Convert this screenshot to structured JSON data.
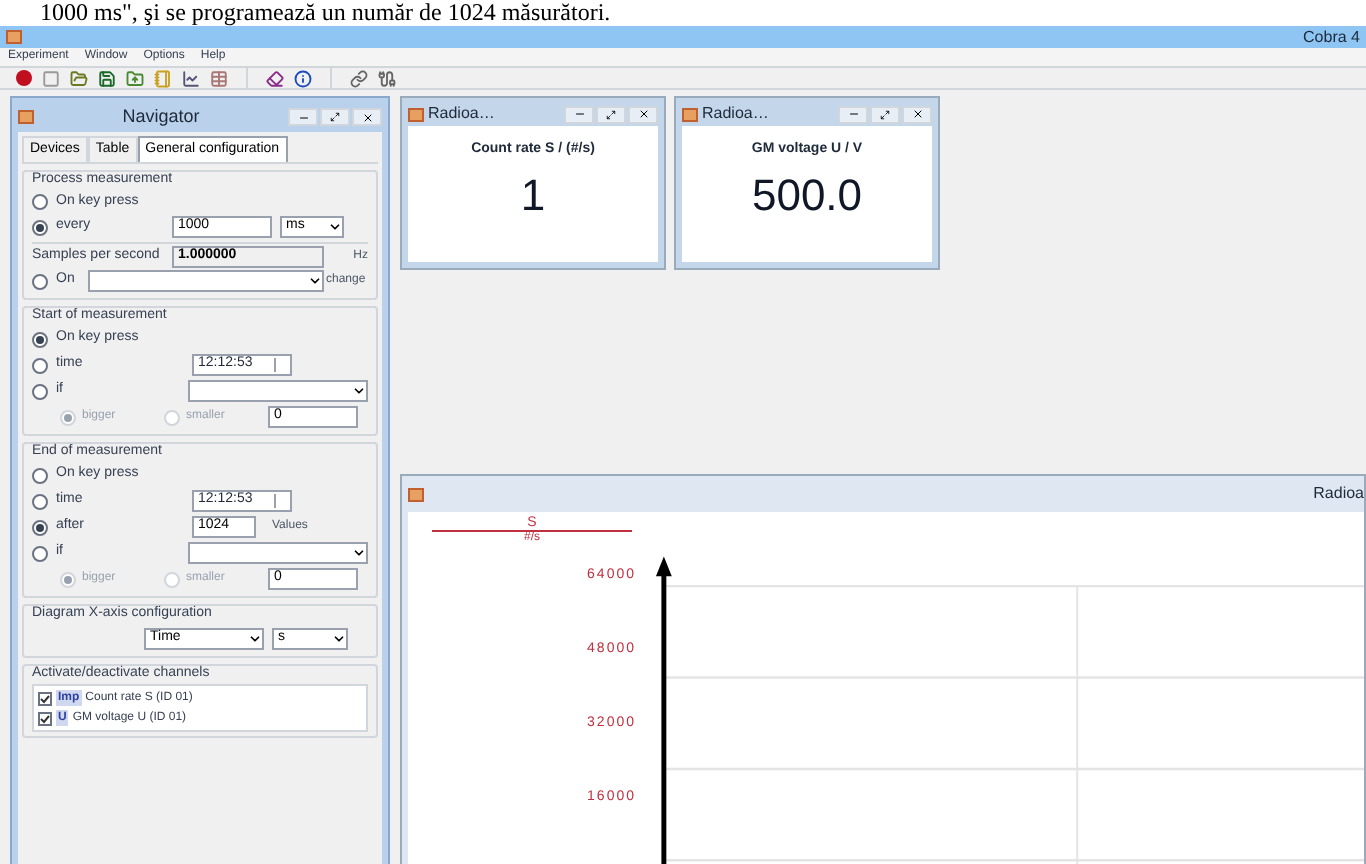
{
  "caption": "1000 ms\", şi se programează un număr de 1024 măsurători.",
  "window": {
    "title": "Cobra 4"
  },
  "menu": [
    "Experiment",
    "Window",
    "Options",
    "Help"
  ],
  "navigator": {
    "title": "Navigator",
    "tabs": [
      {
        "label": "Devices",
        "selected": false
      },
      {
        "label": "Table",
        "selected": false
      },
      {
        "label": "General configuration",
        "selected": true
      }
    ],
    "process": {
      "title": "Process measurement",
      "key_press": {
        "label": "On key press",
        "selected": false
      },
      "every": {
        "label": "every",
        "selected": true,
        "value": "1000",
        "unit": "ms"
      },
      "samples_label": "Samples per second",
      "samples_value": "1.000000",
      "samples_unit": "Hz",
      "on_change": {
        "label": "On",
        "selected": false,
        "action": "change"
      }
    },
    "start": {
      "title": "Start of measurement",
      "options": [
        {
          "kind": "plain",
          "label": "On key press",
          "selected": true
        },
        {
          "kind": "time",
          "label": "time",
          "selected": false,
          "value": "12:12:53"
        },
        {
          "kind": "if",
          "label": "if",
          "selected": false
        }
      ],
      "trigger": [
        {
          "label": "bigger",
          "selected": true
        },
        {
          "label": "smaller",
          "selected": false
        }
      ],
      "threshold": "0"
    },
    "end": {
      "title": "End of measurement",
      "options": [
        {
          "kind": "plain",
          "label": "On key press",
          "selected": false
        },
        {
          "kind": "time",
          "label": "time",
          "selected": false,
          "value": "12:12:53"
        },
        {
          "kind": "count",
          "label": "after",
          "selected": true,
          "value": "1024",
          "unit": "Values"
        },
        {
          "kind": "if",
          "label": "if",
          "selected": false
        }
      ],
      "trigger": [
        {
          "label": "bigger",
          "selected": true
        },
        {
          "label": "smaller",
          "selected": false
        }
      ],
      "threshold": "0"
    },
    "xaxis": {
      "title": "Diagram X-axis configuration",
      "quantity": "Time",
      "unit": "s"
    },
    "channels": {
      "title": "Activate/deactivate channels",
      "items": [
        {
          "symbol": "Imp",
          "label": "Count rate S (ID 01)",
          "checked": true
        },
        {
          "symbol": "U",
          "label": "GM voltage U (ID 01)",
          "checked": true
        }
      ]
    }
  },
  "displays": [
    {
      "title": "Radioa…",
      "label": "Count rate S / (#/s)",
      "value": "1"
    },
    {
      "title": "Radioa…",
      "label": "GM voltage U / V",
      "value": "500.0"
    }
  ],
  "graph": {
    "title": "Radioa",
    "quantity": "S",
    "unit": "#/s",
    "ticks": [
      "64000",
      "48000",
      "32000",
      "16000"
    ]
  }
}
